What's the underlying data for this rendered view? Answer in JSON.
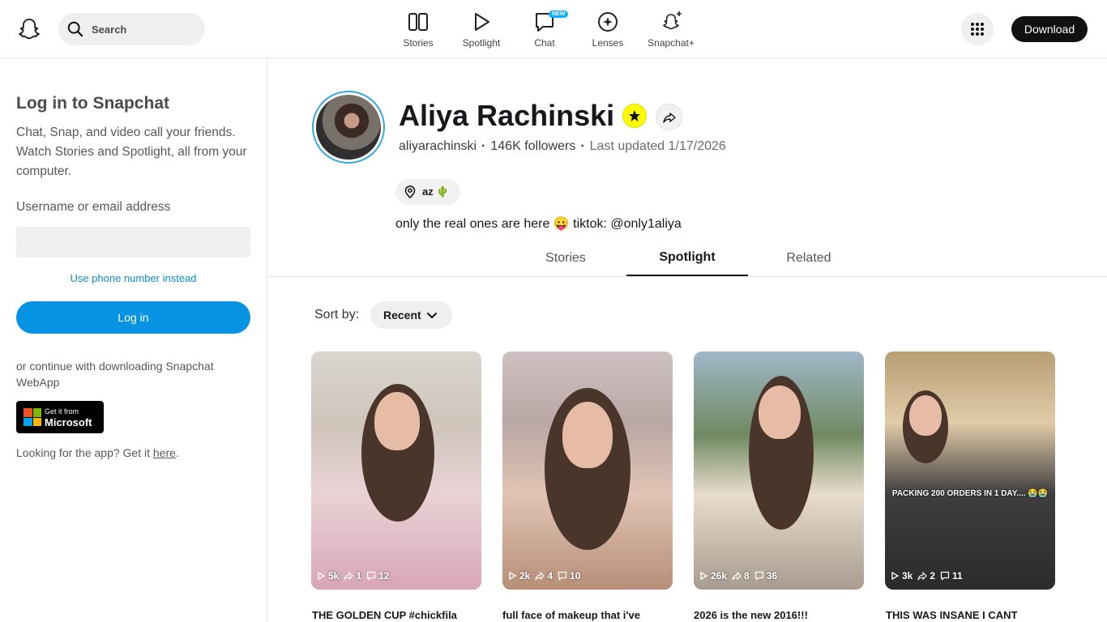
{
  "nav": {
    "search_placeholder": "Search",
    "items": [
      {
        "label": "Stories",
        "icon": "stories-icon"
      },
      {
        "label": "Spotlight",
        "icon": "spotlight-icon"
      },
      {
        "label": "Chat",
        "icon": "chat-icon",
        "badge": "NEW"
      },
      {
        "label": "Lenses",
        "icon": "lenses-icon"
      },
      {
        "label": "Snapchat+",
        "icon": "snapchat-plus-icon"
      }
    ],
    "download_label": "Download"
  },
  "sidebar": {
    "title": "Log in to Snapchat",
    "description": "Chat, Snap, and video call your friends. Watch Stories and Spotlight, all from your computer.",
    "username_label": "Username or email address",
    "username_value": "",
    "phone_link": "Use phone number instead",
    "login_button": "Log in",
    "continue_text": "or continue with downloading Snapchat WebApp",
    "ms_small": "Get it from",
    "ms_big": "Microsoft",
    "looking_text": "Looking for the app? Get it ",
    "looking_link": "here",
    "looking_end": "."
  },
  "profile": {
    "name": "Aliya Rachinski",
    "username": "aliyarachinski",
    "followers": "146K followers",
    "updated": "Last updated 1/17/2026",
    "location": "az 🌵",
    "bio": "only the real ones are here 😛 tiktok: @only1aliya"
  },
  "tabs": [
    {
      "label": "Stories",
      "active": false
    },
    {
      "label": "Spotlight",
      "active": true
    },
    {
      "label": "Related",
      "active": false
    }
  ],
  "sort": {
    "label": "Sort by:",
    "value": "Recent"
  },
  "cards": [
    {
      "views": "5k",
      "shares": "1",
      "comments": "12",
      "title": "THE GOLDEN CUP #chickfila",
      "overlay": ""
    },
    {
      "views": "2k",
      "shares": "4",
      "comments": "10",
      "title": "full face of makeup that i've",
      "overlay": ""
    },
    {
      "views": "26k",
      "shares": "8",
      "comments": "36",
      "title": "2026 is the new 2016!!!",
      "overlay": ""
    },
    {
      "views": "3k",
      "shares": "2",
      "comments": "11",
      "title": "THIS WAS INSANE I CANT",
      "overlay": "PACKING 200 ORDERS IN 1 DAY.... 😭😭"
    }
  ],
  "colors": {
    "accent": "#0693e3",
    "snap_yellow": "#fffc00"
  }
}
